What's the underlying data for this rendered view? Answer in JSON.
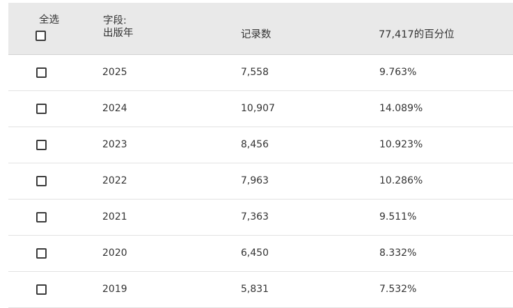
{
  "header": {
    "select_all_label": "全选",
    "field_label": "字段:",
    "field_value": "出版年",
    "count_label": "记录数",
    "percent_label": "77,417的百分位"
  },
  "rows": [
    {
      "year": "2025",
      "count": "7,558",
      "percent": "9.763%"
    },
    {
      "year": "2024",
      "count": "10,907",
      "percent": "14.089%"
    },
    {
      "year": "2023",
      "count": "8,456",
      "percent": "10.923%"
    },
    {
      "year": "2022",
      "count": "7,963",
      "percent": "10.286%"
    },
    {
      "year": "2021",
      "count": "7,363",
      "percent": "9.511%"
    },
    {
      "year": "2020",
      "count": "6,450",
      "percent": "8.332%"
    },
    {
      "year": "2019",
      "count": "5,831",
      "percent": "7.532%"
    }
  ]
}
